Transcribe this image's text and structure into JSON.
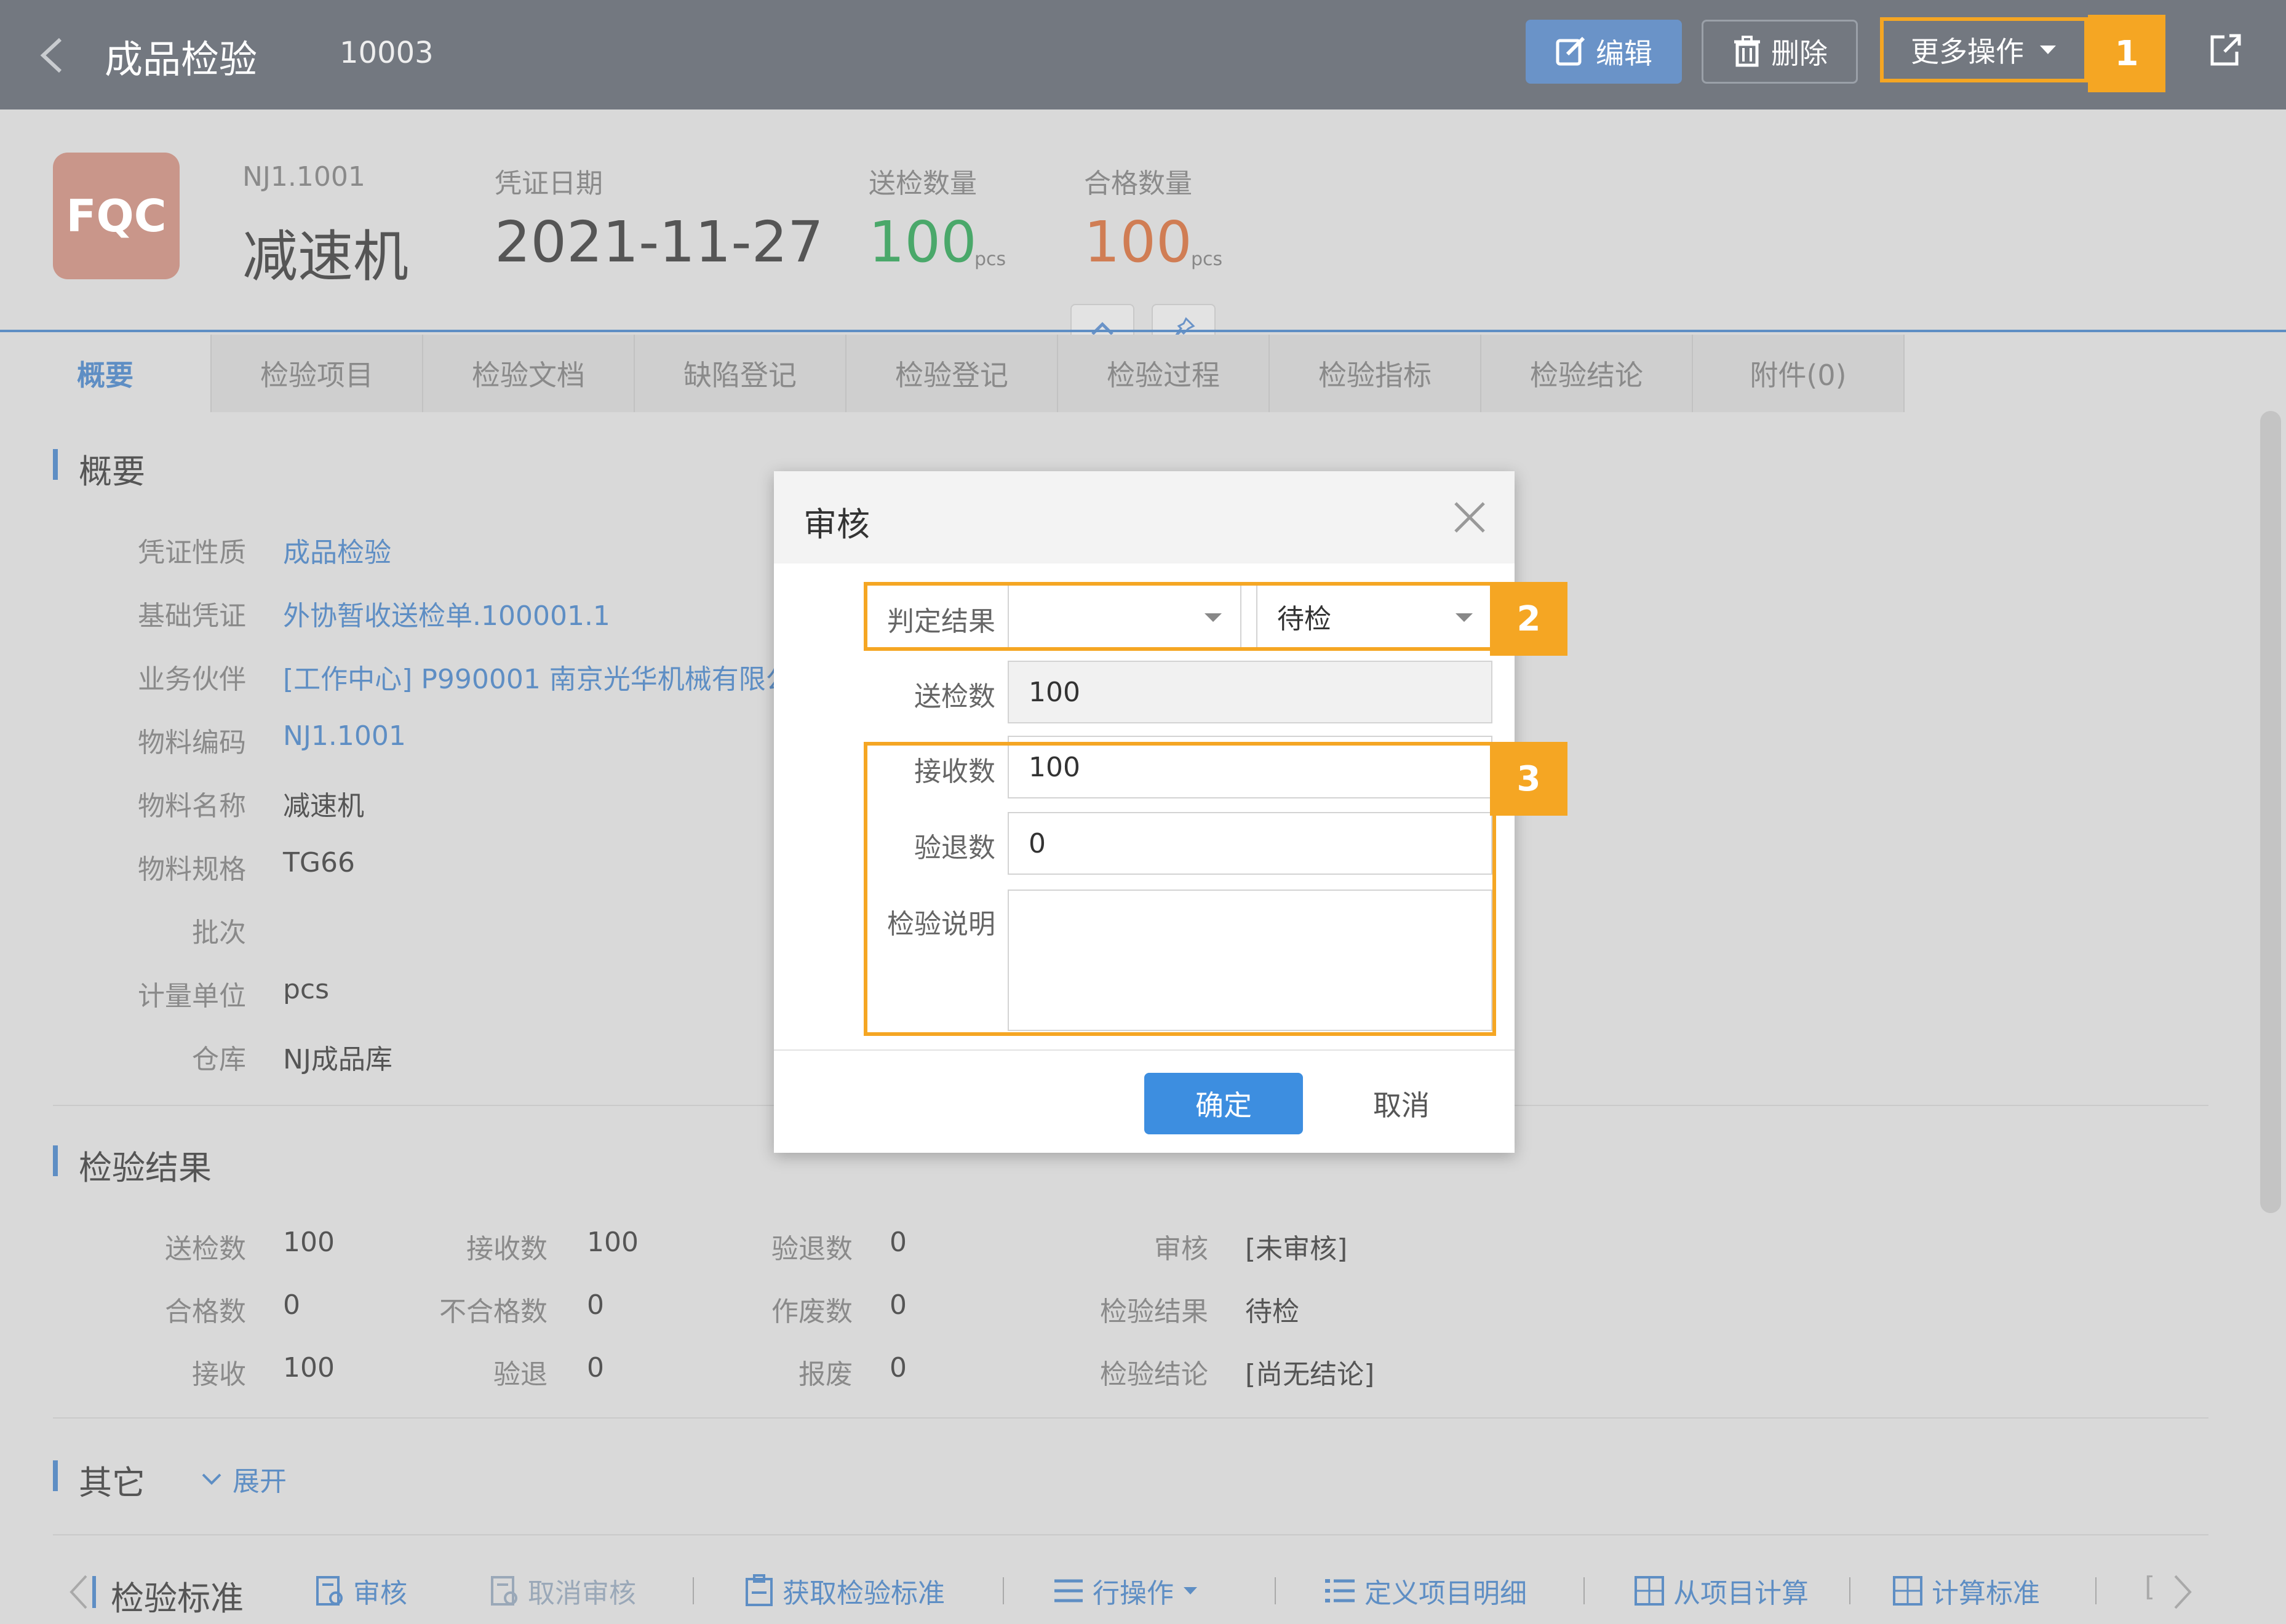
{
  "header": {
    "title": "成品检验",
    "doc_no": "10003",
    "edit_label": "编辑",
    "delete_label": "删除",
    "more_label": "更多操作",
    "badge1": "1"
  },
  "summary": {
    "logo": "FQC",
    "code": "NJ1.1001",
    "name": "减速机",
    "date_label": "凭证日期",
    "date": "2021-11-27",
    "sent_label": "送检数量",
    "sent_value": "100",
    "sent_unit": "pcs",
    "pass_label": "合格数量",
    "pass_value": "100",
    "pass_unit": "pcs"
  },
  "tabs": [
    "概要",
    "检验项目",
    "检验文档",
    "缺陷登记",
    "检验登记",
    "检验过程",
    "检验指标",
    "检验结论",
    "附件(0)"
  ],
  "overview": {
    "title": "概要",
    "rows": [
      {
        "label": "凭证性质",
        "value": "成品检验"
      },
      {
        "label": "基础凭证",
        "value": "外协暂收送检单.100001.1"
      },
      {
        "label": "业务伙伴",
        "value": "[工作中心] P990001 南京光华机械有限公"
      },
      {
        "label": "物料编码",
        "value": "NJ1.1001"
      },
      {
        "label": "物料名称",
        "value": "减速机"
      },
      {
        "label": "物料规格",
        "value": "TG66"
      },
      {
        "label": "批次",
        "value": ""
      },
      {
        "label": "计量单位",
        "value": "pcs"
      },
      {
        "label": "仓库",
        "value": "NJ成品库"
      }
    ]
  },
  "result": {
    "title": "检验结果",
    "rows": [
      [
        {
          "label": "送检数",
          "value": "100"
        },
        {
          "label": "接收数",
          "value": "100"
        },
        {
          "label": "验退数",
          "value": "0"
        },
        {
          "label": "审核",
          "value": "[未审核]"
        }
      ],
      [
        {
          "label": "合格数",
          "value": "0"
        },
        {
          "label": "不合格数",
          "value": "0"
        },
        {
          "label": "作废数",
          "value": "0"
        },
        {
          "label": "检验结果",
          "value": "待检"
        }
      ],
      [
        {
          "label": "接收",
          "value": "100"
        },
        {
          "label": "验退",
          "value": "0"
        },
        {
          "label": "报废",
          "value": "0"
        },
        {
          "label": "检验结论",
          "value": "[尚无结论]"
        }
      ]
    ]
  },
  "other": {
    "title": "其它",
    "expand": "展开"
  },
  "toolbar": {
    "title": "检验标准",
    "approve": "审核",
    "cancel_approve": "取消审核",
    "get_standard": "获取检验标准",
    "row_ops": "行操作",
    "define_items": "定义项目明细",
    "calc_from_items": "从项目计算",
    "calc_standard": "计算标准",
    "trailing": "["
  },
  "modal": {
    "title": "审核",
    "judge_label": "判定结果",
    "judge_value": "",
    "status_value": "待检",
    "sent_label": "送检数",
    "sent_value": "100",
    "accept_label": "接收数",
    "accept_value": "100",
    "return_label": "验退数",
    "return_value": "0",
    "note_label": "检验说明",
    "note_value": "",
    "ok": "确定",
    "cancel": "取消",
    "badge2": "2",
    "badge3": "3"
  }
}
